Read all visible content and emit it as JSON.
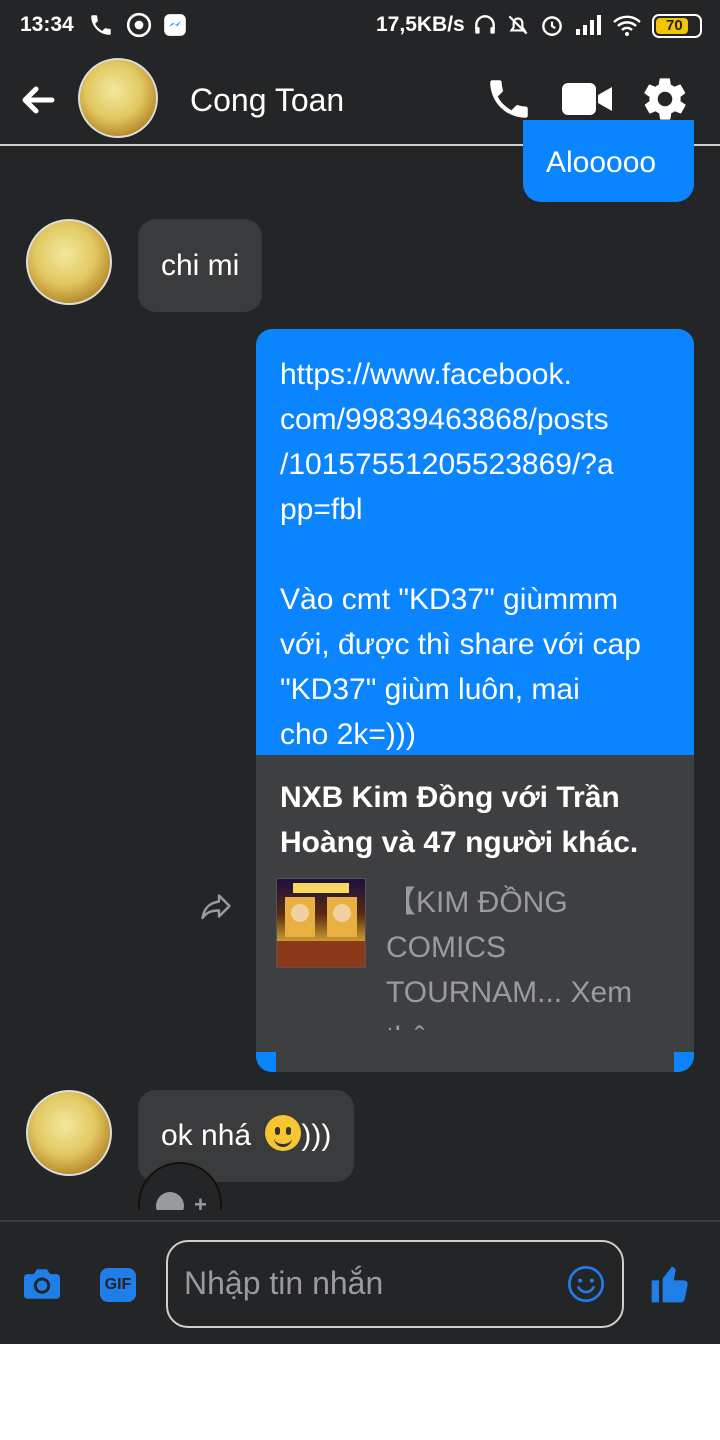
{
  "status_bar": {
    "time": "13:34",
    "network_speed": "17,5KB/s",
    "battery": "70"
  },
  "header": {
    "contact_name": "Cong Toan"
  },
  "messages": {
    "out_1": "Alooooo",
    "in_1": "chi mi",
    "out_link_lines": [
      "https://www.facebook.",
      "com/99839463868/posts",
      "/10157551205523869/?a",
      "pp=fbl"
    ],
    "out_text_lines": [
      "Vào cmt \"KD37\" giùmmm",
      "với, được thì share với cap",
      "\"KD37\" giùm luôn, mai",
      "cho 2k=)))"
    ],
    "card_title": "NXB Kim Đồng với Trần Hoàng và 47 người khác.",
    "card_desc": "【KIM ĐỒNG COMICS TOURNAM... Xem thêm",
    "in_2": "ok nhá",
    "in_2_suffix": ")))"
  },
  "composer": {
    "placeholder": "Nhập tin nhắn"
  },
  "colors": {
    "accent": "#0a84ff",
    "background": "#242526",
    "bubble_in": "#3a3b3c"
  }
}
